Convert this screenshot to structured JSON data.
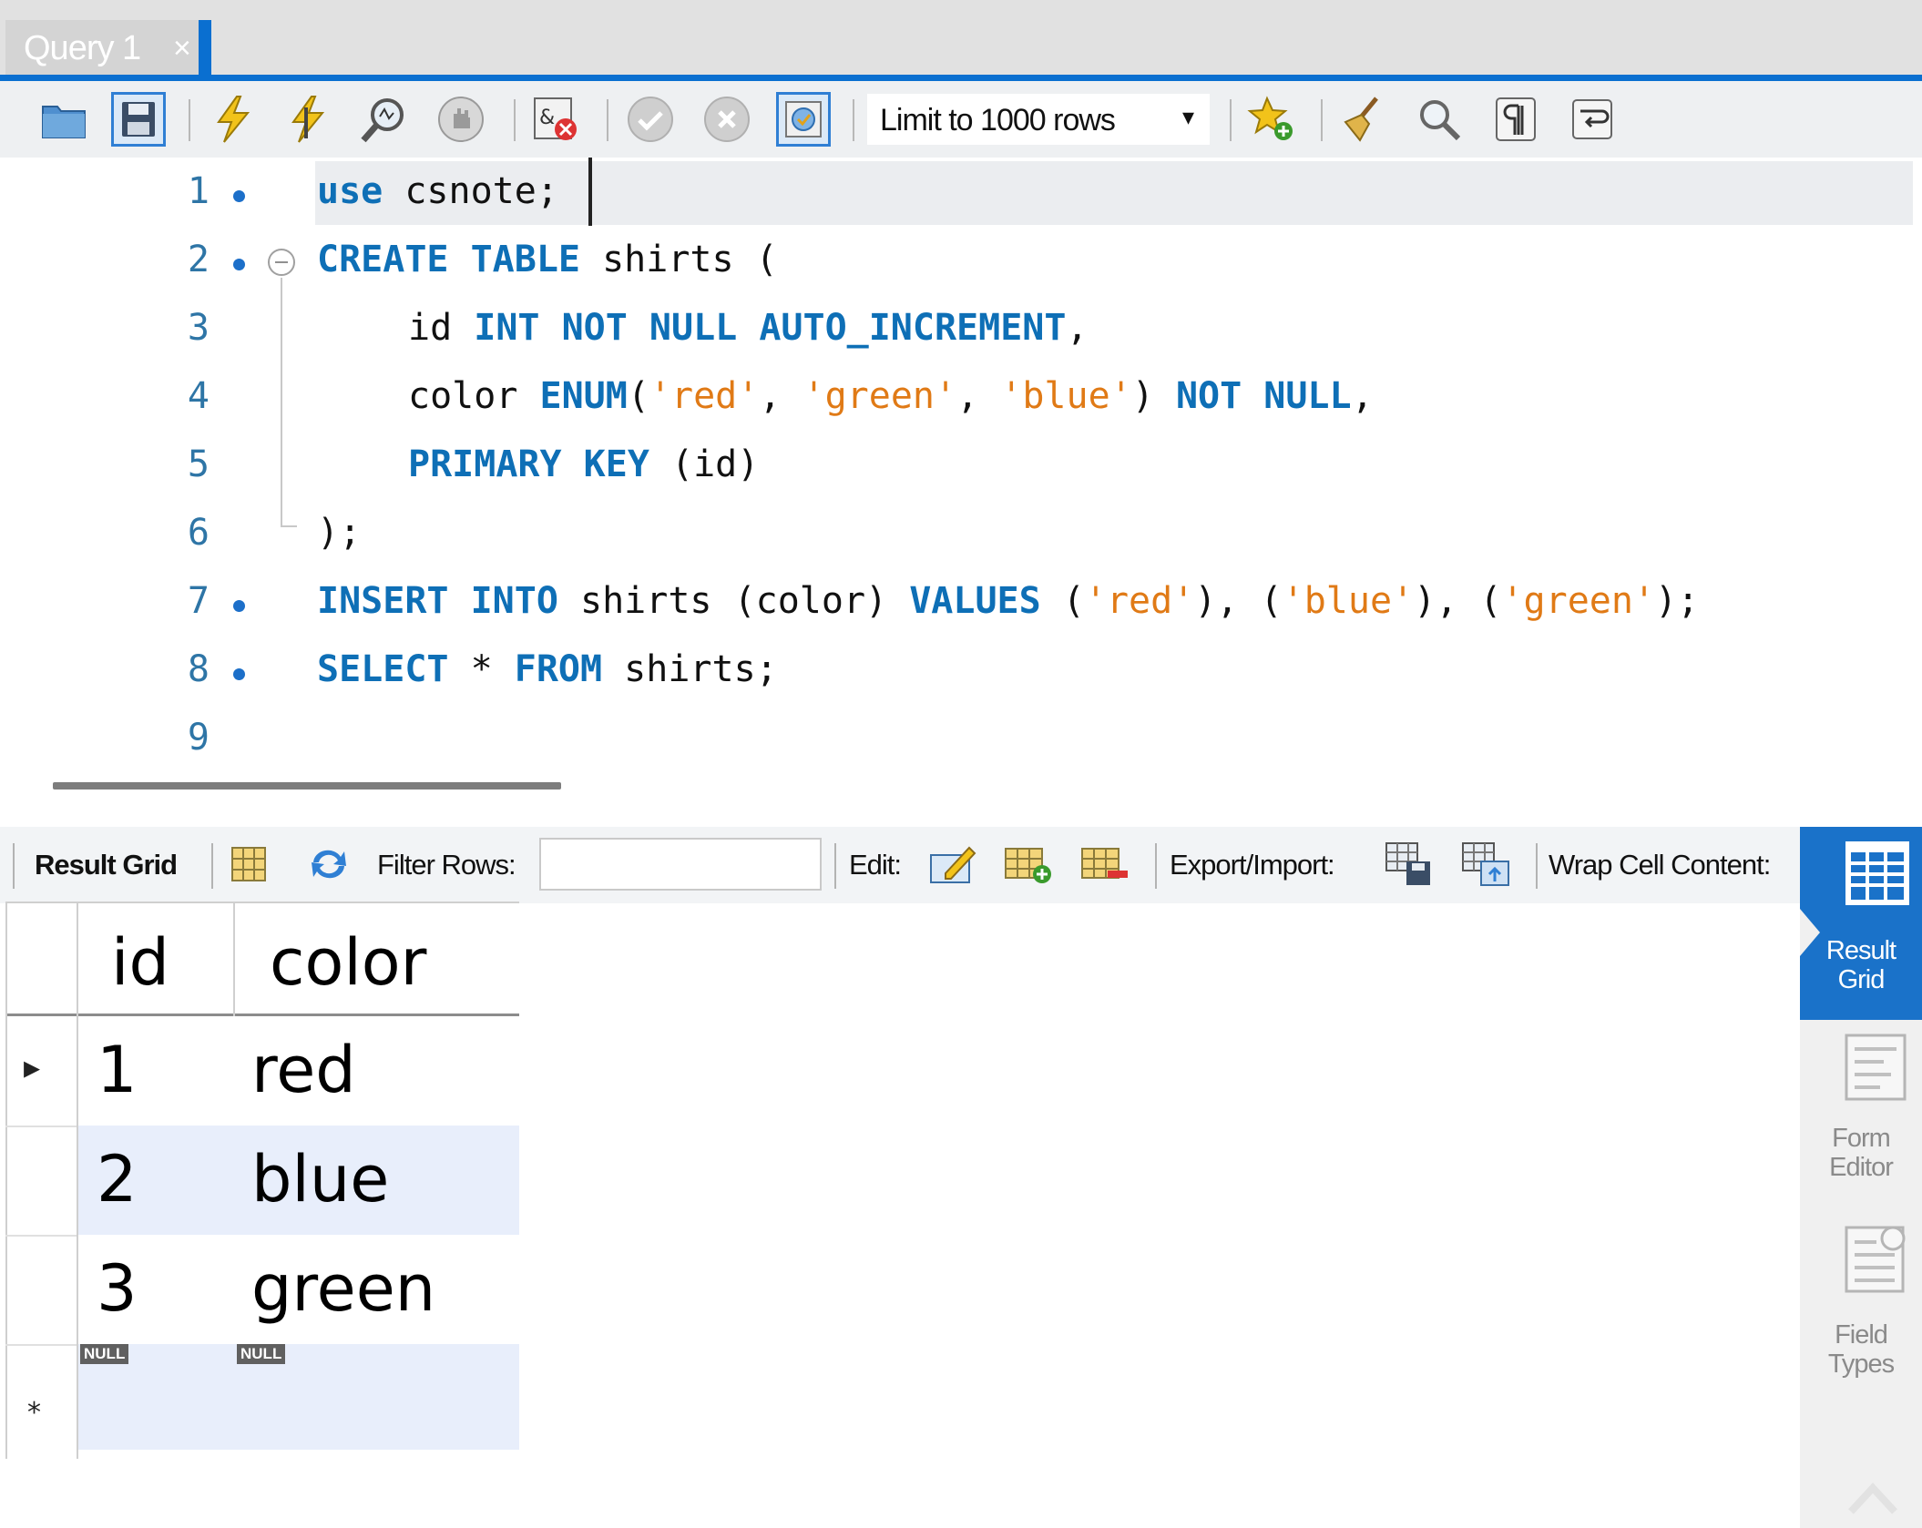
{
  "tab": {
    "title": "Query 1",
    "close": "×"
  },
  "toolbar": {
    "limit_select": {
      "value": "Limit to 1000 rows",
      "caret": "▾"
    },
    "icons": [
      "open-folder-icon",
      "save-icon",
      "execute-icon",
      "execute-current-icon",
      "explain-icon",
      "stop-icon",
      "toggle-error-icon",
      "commit-icon",
      "rollback-icon",
      "autocommit-icon",
      "add-snippet-icon",
      "beautify-icon",
      "find-icon",
      "invisible-chars-icon",
      "wrap-lines-icon"
    ]
  },
  "editor": {
    "lines": [
      {
        "n": "1",
        "dot": true
      },
      {
        "n": "2",
        "dot": true
      },
      {
        "n": "3",
        "dot": false
      },
      {
        "n": "4",
        "dot": false
      },
      {
        "n": "5",
        "dot": false
      },
      {
        "n": "6",
        "dot": false
      },
      {
        "n": "7",
        "dot": true
      },
      {
        "n": "8",
        "dot": true
      },
      {
        "n": "9",
        "dot": false
      }
    ],
    "tokens": {
      "l1_kw": "use",
      "l1_rest": " csnote;",
      "l2_kw": "CREATE TABLE",
      "l2_rest": " shirts (",
      "l3_a": "id ",
      "l3_kw": "INT NOT NULL AUTO_INCREMENT",
      "l3_b": ",",
      "l4_a": "color ",
      "l4_kw1": "ENUM",
      "l4_b": "(",
      "l4_s1": "'red'",
      "l4_c": ", ",
      "l4_s2": "'green'",
      "l4_d": ", ",
      "l4_s3": "'blue'",
      "l4_e": ") ",
      "l4_kw2": "NOT NULL",
      "l4_f": ",",
      "l5_kw": "PRIMARY KEY",
      "l5_rest": " (id)",
      "l6": ");",
      "l7_kw1": "INSERT INTO",
      "l7_a": " shirts (color) ",
      "l7_kw2": "VALUES",
      "l7_b": " (",
      "l7_s1": "'red'",
      "l7_c": "), (",
      "l7_s2": "'blue'",
      "l7_d": "), (",
      "l7_s3": "'green'",
      "l7_e": ");",
      "l8_kw1": "SELECT",
      "l8_a": " * ",
      "l8_kw2": "FROM",
      "l8_b": " shirts;"
    }
  },
  "result_toolbar": {
    "result_grid": "Result Grid",
    "filter_rows": "Filter Rows:",
    "filter_value": "",
    "edit": "Edit:",
    "export_import": "Export/Import:",
    "wrap": "Wrap Cell Content:"
  },
  "grid": {
    "columns": [
      "id",
      "color"
    ],
    "rows": [
      {
        "id": "1",
        "color": "red"
      },
      {
        "id": "2",
        "color": "blue"
      },
      {
        "id": "3",
        "color": "green"
      }
    ],
    "new_row_null": "NULL",
    "selected_row_marker": "▸",
    "new_row_marker": "*"
  },
  "side_panel": {
    "items": [
      {
        "line1": "Result",
        "line2": "Grid",
        "active": true
      },
      {
        "line1": "Form",
        "line2": "Editor",
        "active": false
      },
      {
        "line1": "Field",
        "line2": "Types",
        "active": false
      }
    ]
  },
  "colors": {
    "accent": "#0a6fd0",
    "keyword": "#0e6fb6",
    "string": "#e07a16",
    "line_number": "#2e75a6",
    "alt_row": "#e8eefb"
  }
}
